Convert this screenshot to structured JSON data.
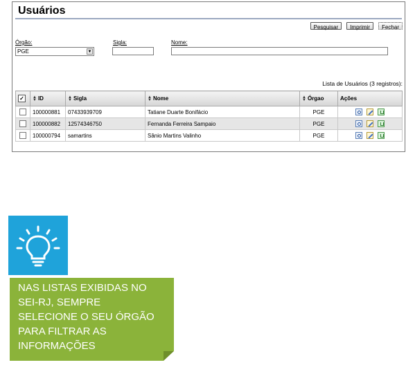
{
  "page": {
    "title": "Usuários"
  },
  "toolbar": {
    "search_label": "Pesquisar",
    "print_label": "Imprimir",
    "close_label": "Fechar"
  },
  "filters": {
    "orgao_label": "Órgão:",
    "orgao_value": "PGE",
    "sigla_label": "Sigla:",
    "sigla_value": "",
    "nome_label": "Nome:",
    "nome_value": ""
  },
  "list": {
    "caption": "Lista de Usuários (3 registros):",
    "columns": [
      "ID",
      "Sigla",
      "Nome",
      "Órgao",
      "Ações"
    ],
    "rows": [
      {
        "id": "100000881",
        "sigla": "07433939709",
        "nome": "Tatiane Duarte Bonifácio",
        "orgao": "PGE"
      },
      {
        "id": "100000882",
        "sigla": "12574346750",
        "nome": "Fernanda Ferreira Sampaio",
        "orgao": "PGE"
      },
      {
        "id": "100000794",
        "sigla": "samartins",
        "nome": "Sânio Martins Valinho",
        "orgao": "PGE"
      }
    ],
    "actions": [
      "view-icon",
      "edit-icon",
      "delete-icon"
    ]
  },
  "tip": {
    "icon": "lightbulb-icon",
    "text": "NAS LISTAS EXIBIDAS NO SEI-RJ, SEMPRE SELECIONE O SEU ÓRGÃO PARA FILTRAR AS INFORMAÇÕES",
    "lines": [
      "NAS LISTAS EXIBIDAS NO",
      "SEI-RJ, SEMPRE",
      "SELECIONE O SEU ÓRGÃO",
      "PARA FILTRAR AS",
      "INFORMAÇÕES"
    ]
  },
  "colors": {
    "tip_green": "#8bb33a",
    "bulb_blue": "#1fa3da",
    "header_rule": "#9aa7c0",
    "row_alt": "#e6e6e6"
  }
}
